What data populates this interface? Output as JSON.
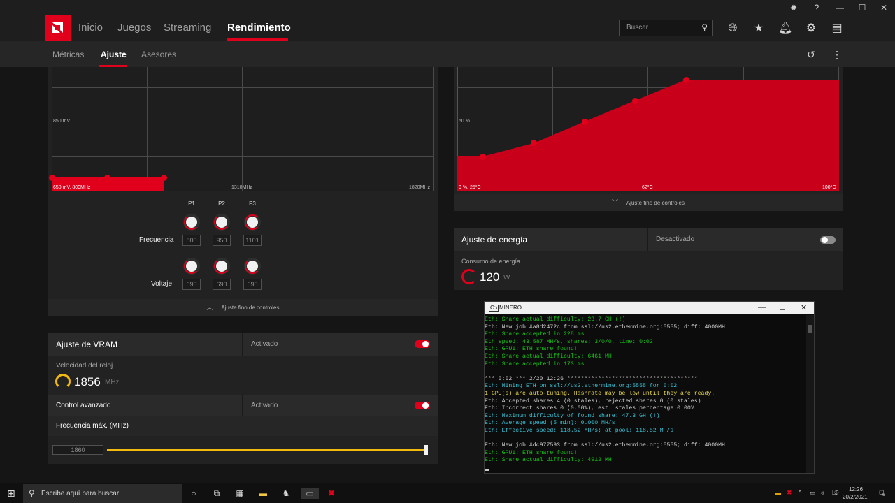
{
  "window_controls": {
    "bug_icon": "bug-icon",
    "help_icon": "help-icon",
    "minimize": "—",
    "maximize": "☐",
    "close": "✕"
  },
  "nav": {
    "tabs": [
      {
        "label": "Inicio"
      },
      {
        "label": "Juegos"
      },
      {
        "label": "Streaming"
      },
      {
        "label": "Rendimiento"
      }
    ],
    "active_tab": "Rendimiento",
    "search_placeholder": "Buscar",
    "accent_color": "#e0001b"
  },
  "subnav": {
    "tabs": [
      {
        "label": "Métricas"
      },
      {
        "label": "Ajuste"
      },
      {
        "label": "Asesores"
      }
    ],
    "active_tab": "Ajuste"
  },
  "gpu_tuning": {
    "voltage_label": "850 mV",
    "bottom_left_label": "650 mV, 800MHz",
    "x_mid_label": "1310MHz",
    "x_max_label": "1820MHz",
    "pstates": [
      "P1",
      "P2",
      "P3"
    ],
    "frequency_label": "Frecuencia",
    "frequency_values": [
      "800",
      "950",
      "1101"
    ],
    "voltage_row_label": "Voltaje",
    "voltage_values": [
      "690",
      "690",
      "690"
    ],
    "fine_tune_label": "Ajuste fino de controles"
  },
  "fan_tuning": {
    "y_mid_label": "50 %",
    "x_min_label": "0 %, 25°C",
    "x_mid_label": "62°C",
    "x_max_label": "100°C",
    "fine_tune_label": "Ajuste fino de controles"
  },
  "power_tuning": {
    "title": "Ajuste de energía",
    "state": "Desactivado",
    "enabled": false,
    "consumption_label": "Consumo de energía",
    "consumption_value": "120",
    "consumption_unit": "W"
  },
  "vram_tuning": {
    "title": "Ajuste de VRAM",
    "state": "Activado",
    "enabled": true,
    "clock_label": "Velocidad del reloj",
    "clock_value": "1856",
    "clock_unit": "MHz",
    "advanced_label": "Control avanzado",
    "advanced_state": "Activado",
    "advanced_enabled": true,
    "max_freq_label": "Frecuencia máx. (MHz)",
    "max_freq_value": "1860",
    "slider_fraction": 1.0
  },
  "terminal": {
    "title": "MINERO",
    "lines": [
      {
        "text": "Eth: Share actual difficulty: 23.7 GH (!)",
        "color": "#17c317"
      },
      {
        "text": "Eth: New job #a8d2472c from ssl://us2.ethermine.org:5555; diff: 4000MH",
        "color": "#cccccc"
      },
      {
        "text": "Eth: Share accepted in 228 ms",
        "color": "#17c317"
      },
      {
        "text": "Eth speed: 43.587 MH/s, shares: 3/0/0, time: 0:02",
        "color": "#17c317"
      },
      {
        "text": "Eth: GPU1: ETH share found!",
        "color": "#17c317"
      },
      {
        "text": "Eth: Share actual difficulty: 6461 MH",
        "color": "#17c317"
      },
      {
        "text": "Eth: Share accepted in 173 ms",
        "color": "#17c317"
      },
      {
        "text": "",
        "color": "#cccccc"
      },
      {
        "text": "*** 0:02 *** 2/20 12:26 **************************************",
        "color": "#cccccc"
      },
      {
        "text": "Eth: Mining ETH on ssl://us2.ethermine.org:5555 for 0:02",
        "color": "#3ac2d6"
      },
      {
        "text": "1 GPU(s) are auto-tuning. Hashrate may be low until they are ready.",
        "color": "#e8d84a"
      },
      {
        "text": "Eth: Accepted shares 4 (0 stales), rejected shares 0 (0 stales)",
        "color": "#cccccc"
      },
      {
        "text": "Eth: Incorrect shares 0 (0.00%), est. stales percentage 0.00%",
        "color": "#cccccc"
      },
      {
        "text": "Eth: Maximum difficulty of found share: 47.3 GH (!)",
        "color": "#3ac2d6"
      },
      {
        "text": "Eth: Average speed (5 min): 0.000 MH/s",
        "color": "#3ac2d6"
      },
      {
        "text": "Eth: Effective speed: 118.52 MH/s; at pool: 118.52 MH/s",
        "color": "#3ac2d6"
      },
      {
        "text": "",
        "color": "#cccccc"
      },
      {
        "text": "Eth: New job #dc977593 from ssl://us2.ethermine.org:5555; diff: 4000MH",
        "color": "#cccccc"
      },
      {
        "text": "Eth: GPU1: ETH share found!",
        "color": "#17c317"
      },
      {
        "text": "Eth: Share actual difficulty: 4912 MH",
        "color": "#17c317"
      }
    ]
  },
  "taskbar": {
    "search_placeholder": "Escribe aquí para buscar",
    "time": "12:26",
    "date": "20/2/2021",
    "notification_count": "6"
  }
}
